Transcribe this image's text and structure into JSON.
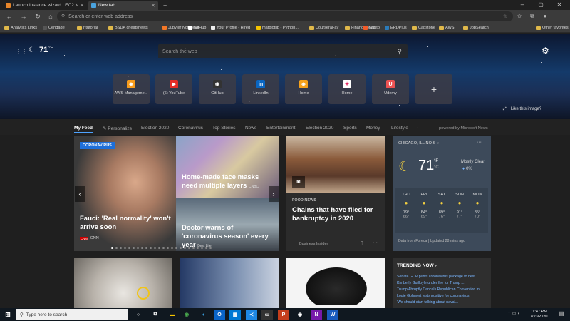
{
  "browser": {
    "tabs": [
      {
        "label": "Launch instance wizard | EC2 M"
      },
      {
        "label": "New tab"
      }
    ],
    "new_tab_symbol": "+",
    "address_placeholder": "Search or enter web address",
    "favorites": [
      "Analytics Links",
      "Cengage",
      "r tutorial",
      "BSDA cheatsheets",
      "Jupyter Notebook",
      "GitHub",
      "Your Profile - Hired",
      "matplotlib - Python...",
      "CourseraFav",
      "Finance Tools",
      "Gusto",
      "ERDPlus",
      "Capstone",
      "AWS",
      "JobSearch",
      "Other favorites"
    ]
  },
  "hero": {
    "temperature": "71",
    "unit": "°F",
    "search_placeholder": "Search the web",
    "tiles": [
      "AWS Manageme...",
      "(6) YouTube",
      "GitHub",
      "LinkedIn",
      "Home",
      "Home",
      "Udemy"
    ],
    "add_symbol": "+",
    "like_image": "Like this image?"
  },
  "feed": {
    "nav": [
      "My Feed",
      "Personalize",
      "Election 2020",
      "Coronavirus",
      "Top Stories",
      "News",
      "Entertainment",
      "Election 2020",
      "Sports",
      "Money",
      "Lifestyle",
      "···"
    ],
    "powered_by": "powered by Microsoft News"
  },
  "cards": {
    "main": {
      "badge": "CORONAVIRUS",
      "headline": "Fauci: 'Real normality' won't arrive soon",
      "source": "CNN"
    },
    "masks": {
      "headline": "Home-made face masks need multiple layers",
      "source": "CNBC"
    },
    "doctor": {
      "headline": "Doctor warns of 'coronavirus season' every year",
      "source": "Best Life"
    },
    "chains": {
      "category": "FOOD NEWS",
      "headline": "Chains that have filed for bankruptcy in 2020",
      "source": "Business Insider"
    },
    "trending": {
      "title": "TRENDING NOW",
      "items": [
        "Senate GOP punts coronavirus package to next...",
        "Kimberly Guilfoyle under fire for Trump ...",
        "Trump Abruptly Cancels Republican Convention in...",
        "Louie Gohmert tests positive for coronavirus",
        "'We should start talking about naval..."
      ]
    }
  },
  "weather": {
    "location": "CHICAGO, ILLINOIS",
    "temp": "71",
    "unit_f": "°F",
    "unit_c": "°C",
    "condition": "Mostly Clear",
    "precip": "0%",
    "days": [
      {
        "d": "THU",
        "hi": "79°",
        "lo": "66°"
      },
      {
        "d": "FRI",
        "hi": "84°",
        "lo": "69°"
      },
      {
        "d": "SAT",
        "hi": "89°",
        "lo": "76°"
      },
      {
        "d": "SUN",
        "hi": "91°",
        "lo": "77°"
      },
      {
        "d": "MON",
        "hi": "85°",
        "lo": "70°"
      }
    ],
    "footer": "Data from Foreca | Updated 28 mins ago"
  },
  "taskbar": {
    "search_placeholder": "Type here to search",
    "time": "11:47 PM",
    "date": "7/23/2020"
  },
  "colors": {
    "accent": "#4ea3ff",
    "badge": "#1e6fd9"
  }
}
